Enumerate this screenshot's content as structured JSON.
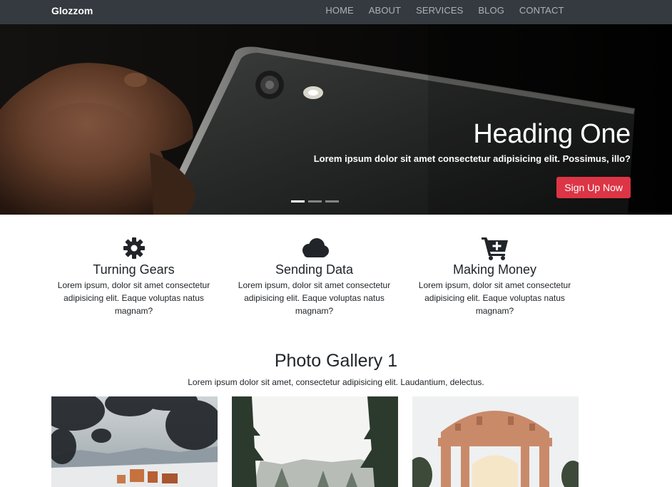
{
  "navbar": {
    "brand": "Glozzom",
    "links": [
      "HOME",
      "ABOUT",
      "SERVICES",
      "BLOG",
      "CONTACT"
    ]
  },
  "hero": {
    "heading": "Heading One",
    "text": "Lorem ipsum dolor sit amet consectetur adipisicing elit. Possimus, illo?",
    "button_label": "Sign Up Now",
    "active_slide": 1,
    "slide_count": 3
  },
  "features": [
    {
      "icon": "gear-icon",
      "title": "Turning Gears",
      "text": "Lorem ipsum, dolor sit amet consectetur adipisicing elit. Eaque voluptas natus magnam?"
    },
    {
      "icon": "cloud-icon",
      "title": "Sending Data",
      "text": "Lorem ipsum, dolor sit amet consectetur adipisicing elit. Eaque voluptas natus magnam?"
    },
    {
      "icon": "cart-plus-icon",
      "title": "Making Money",
      "text": "Lorem ipsum, dolor sit amet consectetur adipisicing elit. Eaque voluptas natus magnam?"
    }
  ],
  "gallery": {
    "title": "Photo Gallery 1",
    "subtitle": "Lorem ipsum dolor sit amet, consectetur adipisicing elit. Laudantium, delectus."
  },
  "colors": {
    "navbar_bg": "#343a40",
    "accent_red": "#dc3545",
    "icon_dark": "#212529"
  }
}
